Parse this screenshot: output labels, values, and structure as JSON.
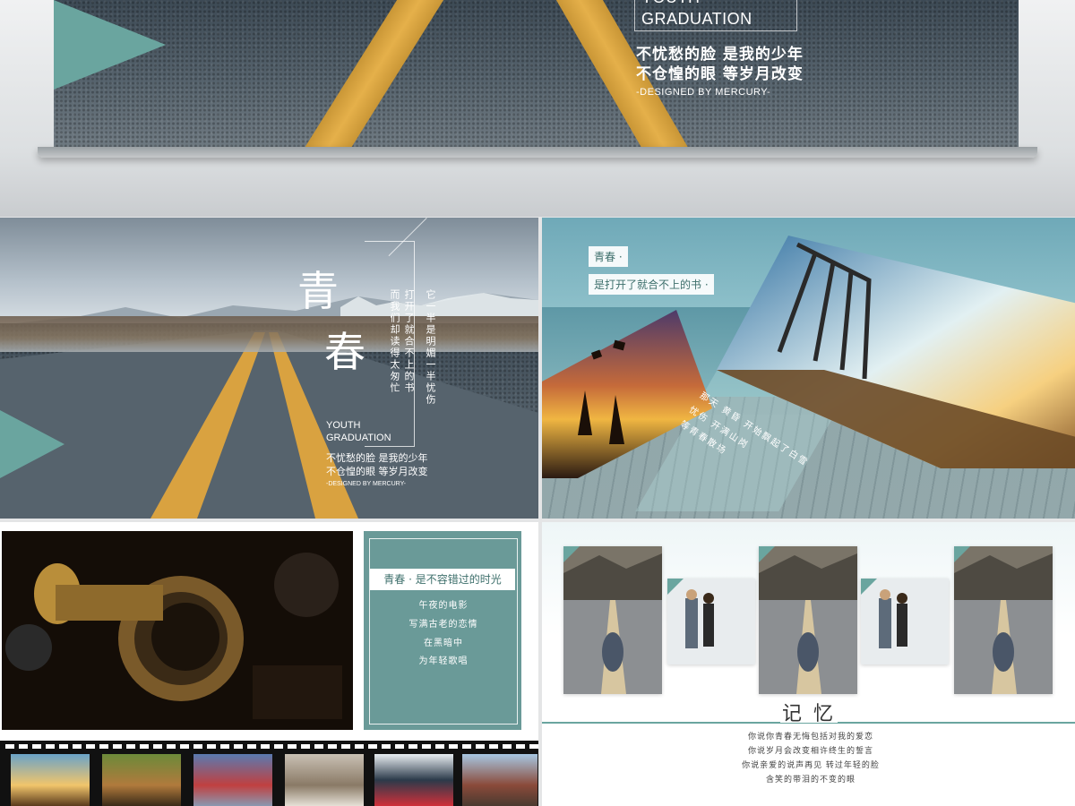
{
  "hero": {
    "en_line1": "YOUTH",
    "en_line2": "GRADUATION",
    "cn_line1": "不忧愁的脸 是我的少年",
    "cn_line2": "不仓惶的眼 等岁月改变",
    "designer": "-DESIGNED BY MERCURY-"
  },
  "slide1": {
    "big_char1": "青",
    "big_char2": "春",
    "vertical_lines": [
      "而我们却读得太匆忙",
      "打开了就合不上的书",
      "它一半是明媚一半忧伤"
    ],
    "en_line1": "YOUTH",
    "en_line2": "GRADUATION",
    "cn_line1": "不忧愁的脸 是我的少年",
    "cn_line2": "不仓惶的眼 等岁月改变",
    "designer": "-DESIGNED BY MERCURY-"
  },
  "slide2": {
    "tag1": "青春 ·",
    "tag2": "是打开了就合不上的书 ·",
    "caption1": "那天 黄昏 开始飘起了白雪",
    "caption2": "忧伤 开满山岗",
    "caption3": "等青春散场"
  },
  "slide3": {
    "title": "青春 · 是不容错过的时光",
    "lines": [
      "午夜的电影",
      "写满古老的恋情",
      "在黑暗中",
      "为年轻歌唱"
    ]
  },
  "slide4": {
    "title": "记 忆",
    "lines": [
      "你说你青春无悔包括对我的爱恋",
      "你说岁月会改变相许终生的誓言",
      "你说亲爱的说声再见 转过年轻的脸",
      "含笑的带泪的不变的眼"
    ]
  },
  "colors": {
    "teal": "#6aa59f",
    "road_yellow": "#e0ab45",
    "asphalt": "#4b5863"
  }
}
